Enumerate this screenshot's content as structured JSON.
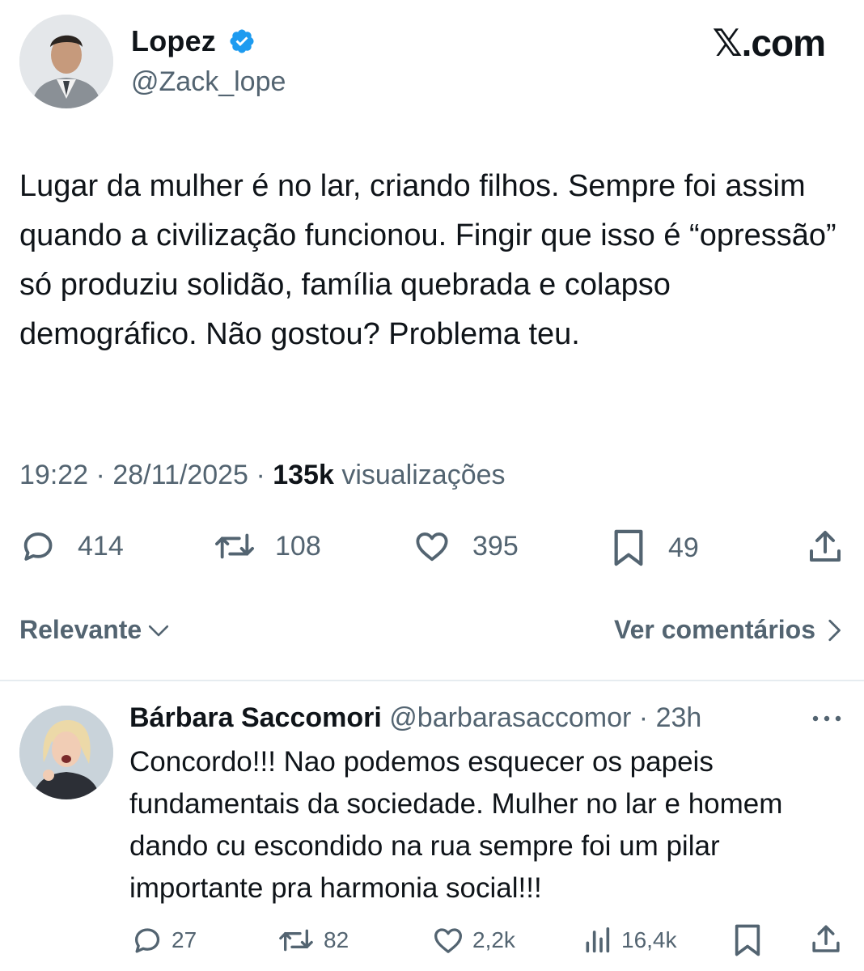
{
  "tweet": {
    "author_name": "Lopez",
    "handle": "@Zack_lope",
    "site_logo": "𝕏.com",
    "text": "Lugar da mulher é no lar, criando filhos. Sempre foi assim quando a civilização funcionou. Fingir que isso é “opressão” só produziu solidão, família quebrada e colapso demográfico. Não gostou? Problema teu.",
    "time": "19:22",
    "date": "28/11/2025",
    "views_count": "135k",
    "views_label": "visualizações",
    "replies": "414",
    "retweets": "108",
    "likes": "395",
    "bookmarks": "49",
    "verified_color": "#1d9bf0"
  },
  "filter": {
    "sort_label": "Relevante",
    "view_comments_label": "Ver comentários"
  },
  "reply": {
    "author_name": "Bárbara Saccomori",
    "handle": "@barbarasaccomor",
    "time": "23h",
    "text": "Concordo!!! Nao podemos esquecer os papeis fundamentais da sociedade. Mulher no lar e homem dando cu escondido na rua sempre foi um pilar importante pra harmonia social!!!",
    "replies": "27",
    "retweets": "82",
    "likes": "2,2k",
    "views": "16,4k"
  },
  "icons": {
    "reply": "speech-bubble-icon",
    "retweet": "retweet-icon",
    "like": "heart-icon",
    "bookmark": "bookmark-icon",
    "share": "share-icon",
    "views": "bar-chart-icon",
    "more": "more-dots-icon"
  },
  "colors": {
    "text": "#0f1419",
    "secondary": "#536471",
    "divider": "#e6ecf0"
  }
}
